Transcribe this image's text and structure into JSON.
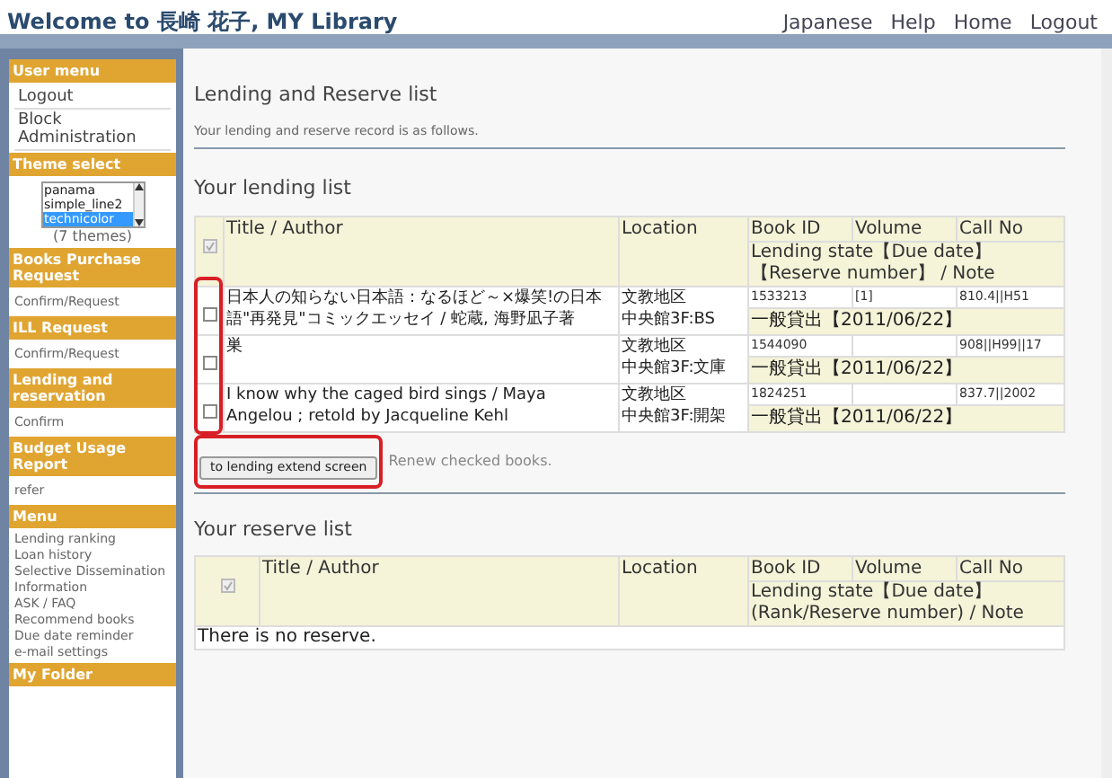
{
  "header": {
    "title": "Welcome to 長崎 花子, MY Library",
    "links": [
      "Japanese",
      "Help",
      "Home",
      "Logout"
    ]
  },
  "sidebar": {
    "sections": [
      {
        "title": "User menu",
        "kind": "large",
        "items": [
          "Logout",
          "Block Administration"
        ]
      },
      {
        "title": "Theme select",
        "kind": "theme",
        "themes": [
          {
            "label": "panama",
            "selected": false
          },
          {
            "label": "simple_line2",
            "selected": false
          },
          {
            "label": "technicolor",
            "selected": true
          }
        ],
        "count": "(7 themes)"
      },
      {
        "title": "Books Purchase Request",
        "kind": "small",
        "items": [
          "Confirm/Request"
        ]
      },
      {
        "title": "ILL Request",
        "kind": "small",
        "items": [
          "Confirm/Request"
        ]
      },
      {
        "title": "Lending and reservation",
        "kind": "small",
        "items": [
          "Confirm"
        ]
      },
      {
        "title": "Budget Usage Report",
        "kind": "small",
        "items": [
          "refer"
        ]
      },
      {
        "title": "Menu",
        "kind": "list",
        "items": [
          "Lending ranking",
          "Loan history",
          "Selective Dissemination Information",
          "ASK / FAQ",
          "Recommend books",
          "Due date reminder",
          "e-mail settings"
        ]
      },
      {
        "title": "My Folder",
        "kind": "small"
      }
    ]
  },
  "main": {
    "title": "Lending and Reserve list",
    "subtitle": "Your lending and reserve record is as follows.",
    "lending": {
      "heading": "Your lending list",
      "header_checked": true,
      "columns": [
        "Title / Author",
        "Location",
        "Book ID",
        "Volume",
        "Call No"
      ],
      "state_header": "Lending state【Due date】【Reserve number】 / Note",
      "checkboxes_highlighted": true,
      "rows": [
        {
          "checked": false,
          "title": "日本人の知らない日本語：なるほど～×爆笑!の日本語\"再発見\"コミックエッセイ / 蛇蔵, 海野凪子著",
          "location": [
            "文教地区",
            "中央館3F:BS"
          ],
          "book_id": "1533213",
          "volume": "[1]",
          "call_no": "810.4||H51",
          "state": "一般貸出【2011/06/22】"
        },
        {
          "checked": false,
          "title": "巣",
          "location": [
            "文教地区",
            "中央館3F:文庫"
          ],
          "book_id": "1544090",
          "call_no": "908||H99||17",
          "state": "一般貸出【2011/06/22】"
        },
        {
          "checked": false,
          "title": "I know why the caged bird sings / Maya Angelou ; retold by Jacqueline Kehl",
          "location": [
            "文教地区",
            "中央館3F:開架"
          ],
          "book_id": "1824251",
          "call_no": "837.7||2002",
          "state": "一般貸出【2011/06/22】"
        }
      ],
      "button": {
        "label": "to lending extend screen",
        "highlighted": true
      },
      "button_note": "Renew checked books."
    },
    "reserve": {
      "heading": "Your reserve list",
      "header_checked": true,
      "columns": [
        "Title / Author",
        "Location",
        "Book ID",
        "Volume",
        "Call No"
      ],
      "state_header": "Lending state【Due date】(Rank/Reserve number) / Note",
      "empty": "There is no reserve."
    }
  }
}
